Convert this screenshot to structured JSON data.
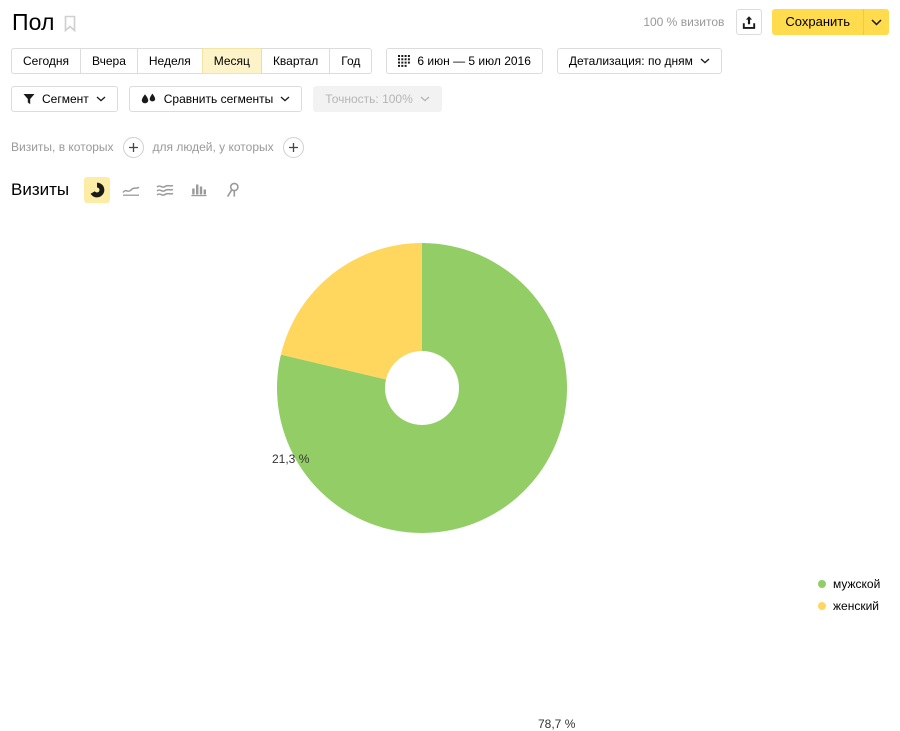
{
  "header": {
    "title": "Пол",
    "bookmark_icon": "bookmark-icon",
    "visits_percent": "100 % визитов",
    "export_icon": "export-icon",
    "save_label": "Сохранить",
    "save_menu_icon": "chevron-down-icon"
  },
  "period": {
    "buttons": [
      {
        "label": "Сегодня",
        "active": false
      },
      {
        "label": "Вчера",
        "active": false
      },
      {
        "label": "Неделя",
        "active": false
      },
      {
        "label": "Месяц",
        "active": true
      },
      {
        "label": "Квартал",
        "active": false
      },
      {
        "label": "Год",
        "active": false
      }
    ],
    "date_range": "6 июн — 5 июл 2016",
    "calendar_icon": "calendar-icon",
    "detail_label": "Детализация: по дням",
    "detail_chevron_icon": "chevron-down-icon"
  },
  "segments": {
    "segment_label": "Сегмент",
    "segment_icon": "funnel-icon",
    "compare_label": "Сравнить сегменты",
    "compare_icon": "droplets-icon",
    "accuracy_label": "Точность: 100%",
    "accuracy_disabled": true,
    "chevron_icon": "chevron-down-icon"
  },
  "conditions": {
    "visits_text": "Визиты, в которых",
    "people_text": "для людей, у которых",
    "add_icon": "plus-icon"
  },
  "metric": {
    "label": "Визиты",
    "chart_types": [
      {
        "name": "pie-chart-icon",
        "active": true
      },
      {
        "name": "line-chart-icon",
        "active": false
      },
      {
        "name": "area-chart-icon",
        "active": false
      },
      {
        "name": "bar-chart-icon",
        "active": false
      },
      {
        "name": "map-chart-icon",
        "active": false
      }
    ]
  },
  "chart_data": {
    "type": "pie",
    "title": "Визиты",
    "donut": true,
    "inner_radius_ratio": 0.255,
    "start_angle_deg": 0,
    "direction": "clockwise",
    "categories": [
      "мужской",
      "женский"
    ],
    "values": [
      78.7,
      21.3
    ],
    "labels": [
      "78,7 %",
      "21,3 %"
    ],
    "colors": [
      "#92ce65",
      "#ffd75e"
    ],
    "legend_position": "right",
    "legend": [
      {
        "label": "мужской",
        "color": "#92ce65"
      },
      {
        "label": "женский",
        "color": "#ffd75e"
      }
    ]
  },
  "theme": {
    "accent_yellow": "#ffdb4d",
    "active_tab_bg": "#fdf3c8",
    "green": "#92ce65",
    "yellow": "#ffd75e",
    "border": "#dcdcdc",
    "muted_text": "#999999"
  }
}
